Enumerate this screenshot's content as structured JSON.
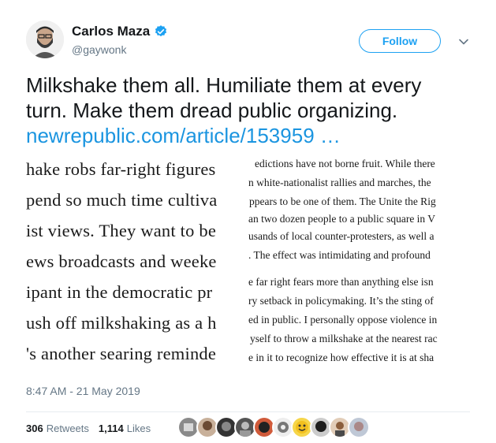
{
  "header": {
    "display_name": "Carlos Maza",
    "handle": "@gaywonk",
    "follow_label": "Follow"
  },
  "tweet": {
    "line1": "Milkshake them all. Humiliate them at every",
    "line2": "turn. Make them dread public organizing.",
    "link": "newrepublic.com/article/153959 …"
  },
  "media": {
    "left_lines": [
      "hake robs far-right figures",
      "pend so much time cultiva",
      "ist views. They want to be",
      "ews broadcasts and weeke",
      "ipant in the democratic pr",
      "ush off milkshaking as a h",
      "'s another searing reminde"
    ],
    "right_lines": [
      "edictions have not borne fruit. While there",
      "n white-nationalist rallies and marches, the",
      "ppears to be one of them. The Unite the Rig",
      "an two dozen people to a public square in V",
      "usands of local counter-protesters, as well a",
      ". The effect was intimidating and profound",
      "e far right fears more than anything else isn",
      "ry setback in policymaking. It’s the sting of",
      "ed in public. I personally oppose violence in",
      "yself to throw a milkshake at the nearest rac",
      "e in it to recognize how effective it is at sha"
    ]
  },
  "timestamp": "8:47 AM - 21 May 2019",
  "stats": {
    "retweets_count": "306",
    "retweets_label": "Retweets",
    "likes_count": "1,114",
    "likes_label": "Likes"
  },
  "colors": {
    "accent": "#1da1f2",
    "link": "#1b95e0",
    "muted": "#657786"
  }
}
